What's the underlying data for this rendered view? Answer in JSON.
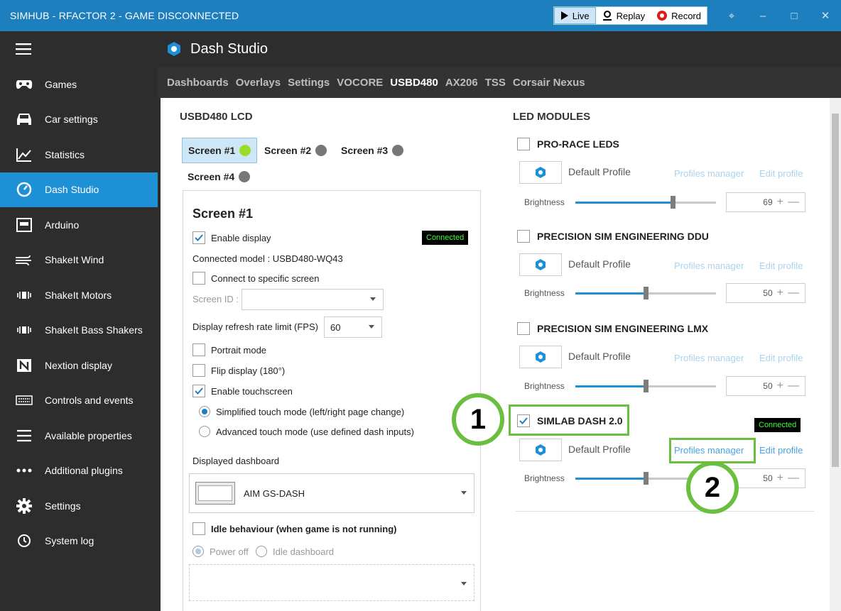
{
  "window": {
    "title": "SIMHUB - RFACTOR 2 - GAME DISCONNECTED",
    "modes": [
      {
        "label": "Live",
        "icon": "play-icon",
        "active": true
      },
      {
        "label": "Replay",
        "icon": "replay-icon",
        "active": false
      },
      {
        "label": "Record",
        "icon": "record-icon",
        "active": false
      }
    ],
    "controls": [
      "pin-icon",
      "minimize-icon",
      "maximize-icon",
      "close-icon"
    ]
  },
  "sidebar": {
    "items": [
      {
        "label": "Games",
        "icon": "gamepad-icon"
      },
      {
        "label": "Car settings",
        "icon": "car-icon"
      },
      {
        "label": "Statistics",
        "icon": "chart-icon"
      },
      {
        "label": "Dash Studio",
        "icon": "gauge-icon",
        "active": true
      },
      {
        "label": "Arduino",
        "icon": "arduino-icon"
      },
      {
        "label": "ShakeIt Wind",
        "icon": "wind-icon"
      },
      {
        "label": "ShakeIt Motors",
        "icon": "vibration-icon"
      },
      {
        "label": "ShakeIt Bass Shakers",
        "icon": "vibration-icon"
      },
      {
        "label": "Nextion display",
        "icon": "nextion-icon"
      },
      {
        "label": "Controls and events",
        "icon": "keyboard-icon"
      },
      {
        "label": "Available properties",
        "icon": "list-icon"
      },
      {
        "label": "Additional plugins",
        "icon": "more-icon"
      },
      {
        "label": "Settings",
        "icon": "gear-icon"
      },
      {
        "label": "System log",
        "icon": "history-icon"
      }
    ]
  },
  "header": {
    "title": "Dash Studio"
  },
  "tabs": [
    {
      "label": "Dashboards",
      "active": false
    },
    {
      "label": "Overlays",
      "active": false
    },
    {
      "label": "Settings",
      "active": false
    },
    {
      "label": "VOCORE",
      "active": false
    },
    {
      "label": "USBD480",
      "active": true
    },
    {
      "label": "AX206",
      "active": false
    },
    {
      "label": "TSS",
      "active": false
    },
    {
      "label": "Corsair Nexus",
      "active": false
    }
  ],
  "usbd": {
    "section_title": "USBD480 LCD",
    "screens": [
      "Screen #1",
      "Screen #2",
      "Screen #3",
      "Screen #4"
    ],
    "panel": {
      "title": "Screen #1",
      "enable_display": "Enable display",
      "status": "Connected",
      "connected_model": "Connected model : USBD480-WQ43",
      "connect_specific": "Connect to specific screen",
      "screen_id_label": "Screen ID :",
      "refresh_label": "Display refresh rate limit (FPS)",
      "refresh_value": "60",
      "portrait": "Portrait mode",
      "flip": "Flip display (180°)",
      "touch": "Enable touchscreen",
      "simplified": "Simplified touch mode (left/right page change)",
      "advanced": "Advanced touch mode (use defined dash inputs)",
      "displayed_label": "Displayed dashboard",
      "dashboard": "AIM GS-DASH",
      "idle_label": "Idle behaviour (when game is not running)",
      "power_off": "Power off",
      "idle_dash": "Idle dashboard"
    }
  },
  "led": {
    "section_title": "LED MODULES",
    "profile_label": "Default Profile",
    "profiles_manager": "Profiles manager",
    "edit_profile": "Edit profile",
    "brightness_label": "Brightness",
    "modules": [
      {
        "name": "PRO-RACE LEDS",
        "checked": false,
        "brightness": "69",
        "level": 0.69
      },
      {
        "name": "PRECISION SIM ENGINEERING DDU",
        "checked": false,
        "brightness": "50",
        "level": 0.5
      },
      {
        "name": "PRECISION SIM ENGINEERING LMX",
        "checked": false,
        "brightness": "50",
        "level": 0.5
      },
      {
        "name": "SIMLAB DASH 2.0",
        "checked": true,
        "brightness": "50",
        "level": 0.5,
        "status": "Connected"
      }
    ]
  },
  "callouts": [
    "1",
    "2"
  ],
  "colors": {
    "accent": "#1e90d6",
    "titlebar": "#1e7fbf",
    "callout": "#6bbf3f"
  }
}
